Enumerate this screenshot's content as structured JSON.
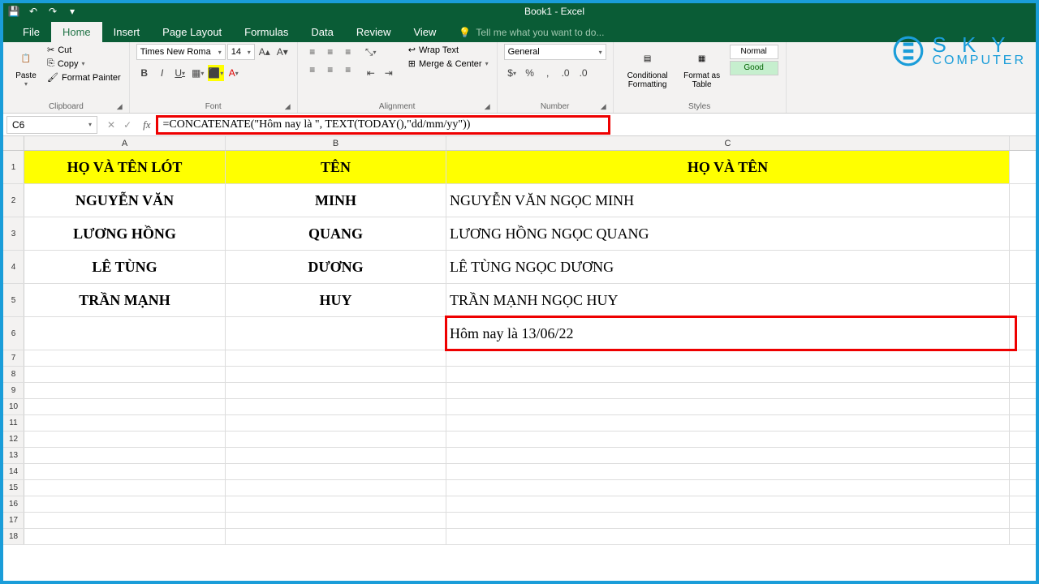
{
  "title": "Book1 - Excel",
  "tabs": {
    "file": "File",
    "home": "Home",
    "insert": "Insert",
    "pagelayout": "Page Layout",
    "formulas": "Formulas",
    "data": "Data",
    "review": "Review",
    "view": "View",
    "tellme": "Tell me what you want to do..."
  },
  "ribbon": {
    "clipboard": {
      "paste": "Paste",
      "cut": "Cut",
      "copy": "Copy",
      "painter": "Format Painter",
      "label": "Clipboard"
    },
    "font": {
      "name": "Times New Roma",
      "size": "14",
      "label": "Font"
    },
    "alignment": {
      "wrap": "Wrap Text",
      "merge": "Merge & Center",
      "label": "Alignment"
    },
    "number": {
      "format": "General",
      "label": "Number"
    },
    "styles": {
      "conditional": "Conditional Formatting",
      "formatas": "Format as Table",
      "normal": "Normal",
      "good": "Good",
      "label": "Styles"
    }
  },
  "namebox": "C6",
  "formula": "=CONCATENATE(\"Hôm nay là \", TEXT(TODAY(),\"dd/mm/yy\"))",
  "columns": [
    "A",
    "B",
    "C"
  ],
  "sheet": {
    "headers": [
      "HỌ VÀ TÊN LÓT",
      "TÊN",
      "HỌ VÀ TÊN"
    ],
    "rows": [
      [
        "NGUYỄN VĂN",
        "MINH",
        "NGUYỄN VĂN  NGỌC MINH"
      ],
      [
        "LƯƠNG HỒNG",
        "QUANG",
        "LƯƠNG HỒNG NGỌC QUANG"
      ],
      [
        "LÊ TÙNG",
        "DƯƠNG",
        "LÊ TÙNG NGỌC DƯƠNG"
      ],
      [
        "TRẦN MẠNH",
        "HUY",
        "TRẦN MẠNH NGỌC HUY"
      ]
    ],
    "c6": "Hôm nay là 13/06/22"
  },
  "logo": {
    "l1": "S K Y",
    "l2": "COMPUTER"
  }
}
